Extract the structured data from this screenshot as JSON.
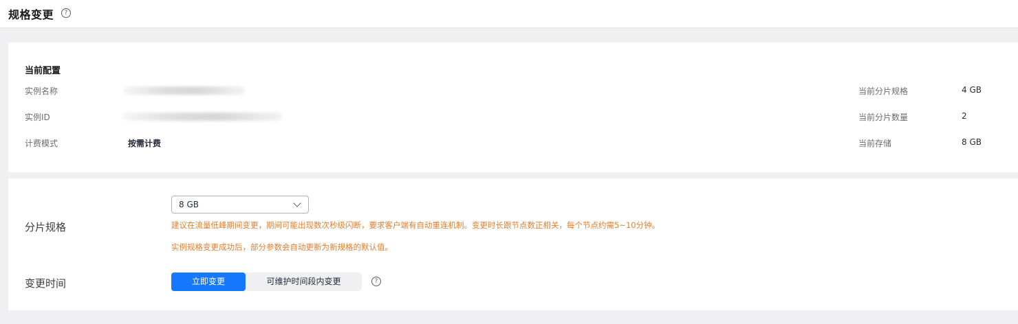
{
  "header": {
    "title": "规格变更",
    "help_icon": "?"
  },
  "current_config": {
    "title": "当前配置",
    "instance_name_label": "实例名称",
    "instance_id_label": "实例ID",
    "billing_mode_label": "计费模式",
    "billing_mode_value": "按需计费",
    "shard_spec_label": "当前分片规格",
    "shard_spec_value": "4 GB",
    "shard_count_label": "当前分片数量",
    "shard_count_value": "2",
    "storage_label": "当前存储",
    "storage_value": "8 GB"
  },
  "change_form": {
    "shard_spec_label": "分片规格",
    "shard_spec_selected": "8 GB",
    "warning_1": "建议在流量低峰期间变更，期间可能出现数次秒级闪断，要求客户端有自动重连机制。变更时长跟节点数正相关，每个节点约需5~10分钟。",
    "warning_2": "实例规格变更成功后，部分参数会自动更新为新规格的默认值。",
    "change_time_label": "变更时间",
    "change_now_label": "立即变更",
    "change_in_window_label": "可维护时间段内变更",
    "help_icon": "?"
  },
  "colors": {
    "primary": "#1677ff",
    "warning": "#e37d2b",
    "page_bg": "#f0f0f2"
  }
}
